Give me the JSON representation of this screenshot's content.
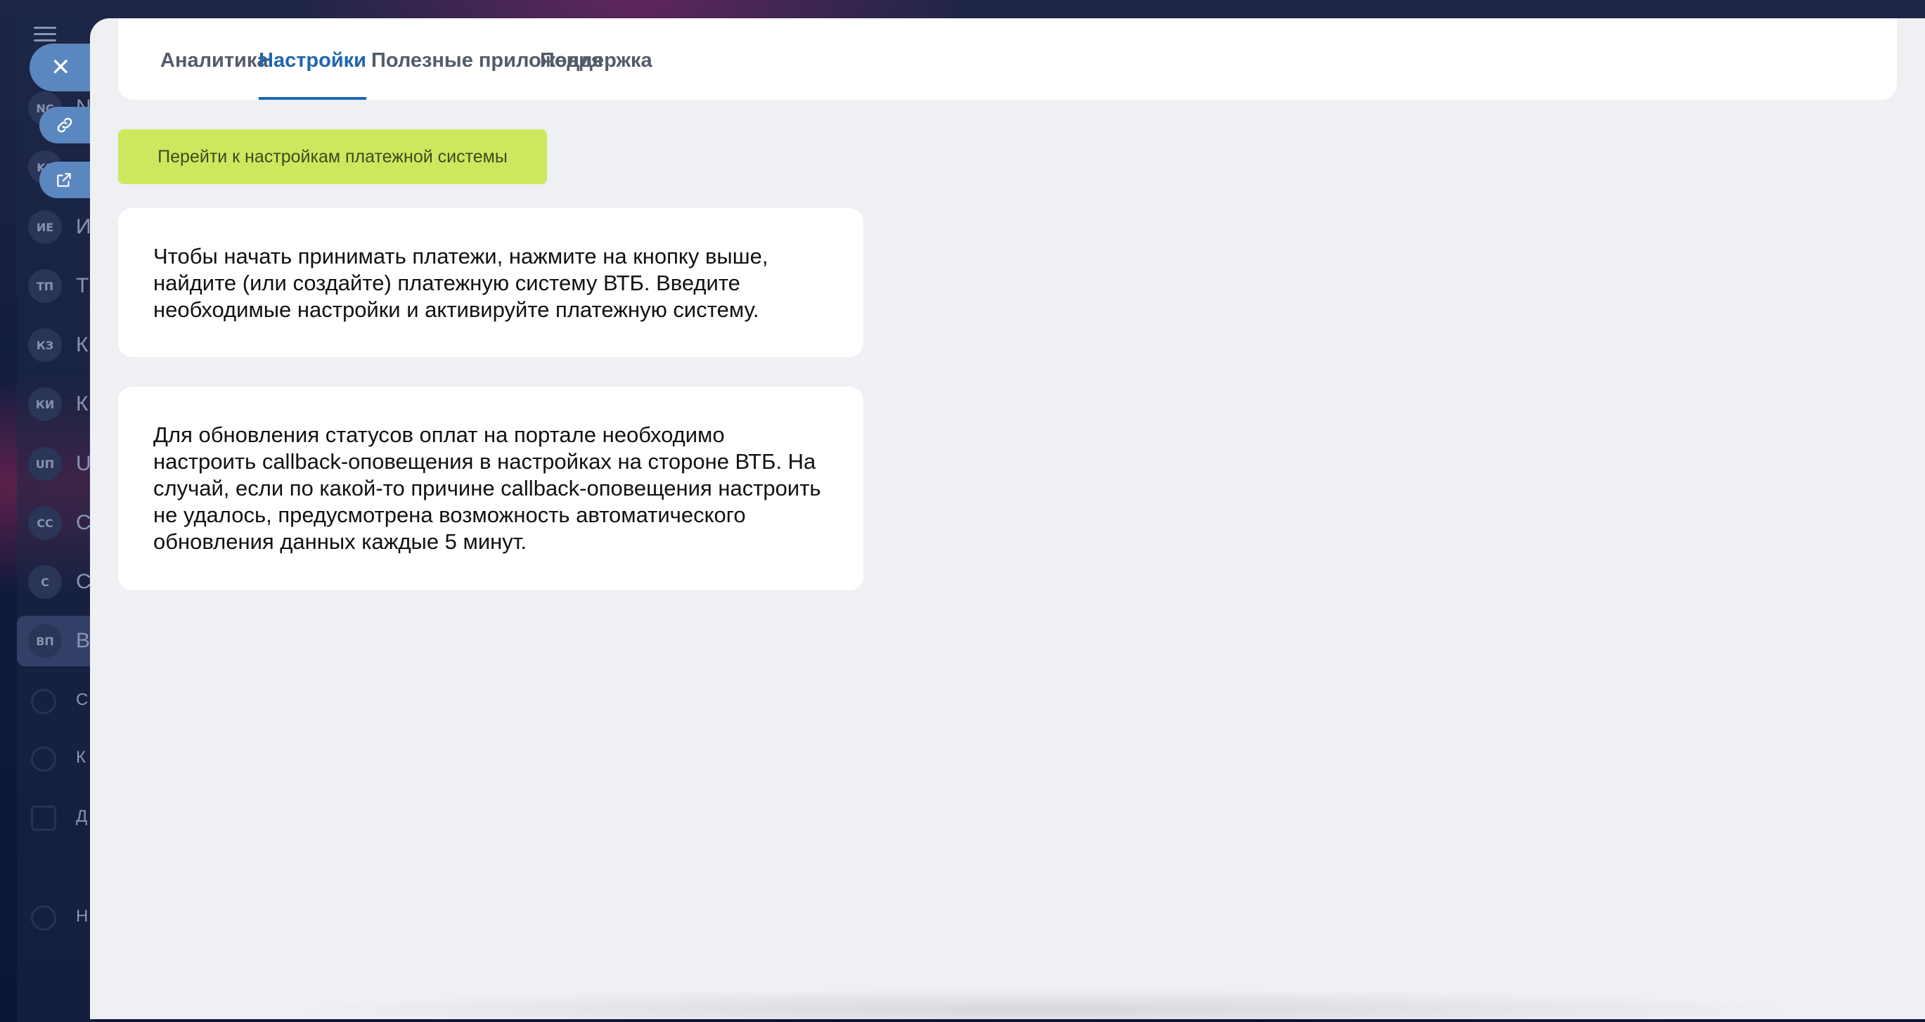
{
  "tabs": [
    {
      "label": "Аналитика"
    },
    {
      "label": "Настройки"
    },
    {
      "label": "Полезные приложения"
    },
    {
      "label": "Поддержка"
    }
  ],
  "active_tab": "Настройки",
  "cta_button": "Перейти к настройкам платежной системы",
  "cards": [
    {
      "text": "Чтобы начать принимать платежи, нажмите на кнопку выше, найдите (или создайте) платежную систему ВТБ. Введите необходимые настройки и активируйте платежную систему."
    },
    {
      "text": "Для обновления статусов оплат на портале необходимо настроить callback-оповещения в настройках на стороне ВТБ. На случай, если по какой-то причине callback-оповещения настроить не удалось, предусмотрена возможность автоматического обновления данных каждые 5 минут."
    }
  ],
  "sidebar_avatars": [
    "NC",
    "KC",
    "ИЕ",
    "ТП",
    "КЗ",
    "КИ",
    "UП",
    "CC",
    "C",
    "ВП"
  ],
  "sidebar_letters": [
    "N",
    "K",
    "И",
    "Т",
    "К",
    "К",
    "U",
    "С",
    "С",
    "В",
    "С",
    "К",
    "Д",
    "Н"
  ],
  "colors": {
    "accent": "#2066b0",
    "cta_bg": "#cde85f",
    "panel_bg": "#eef0f3",
    "side_button": "#5b87c0"
  }
}
